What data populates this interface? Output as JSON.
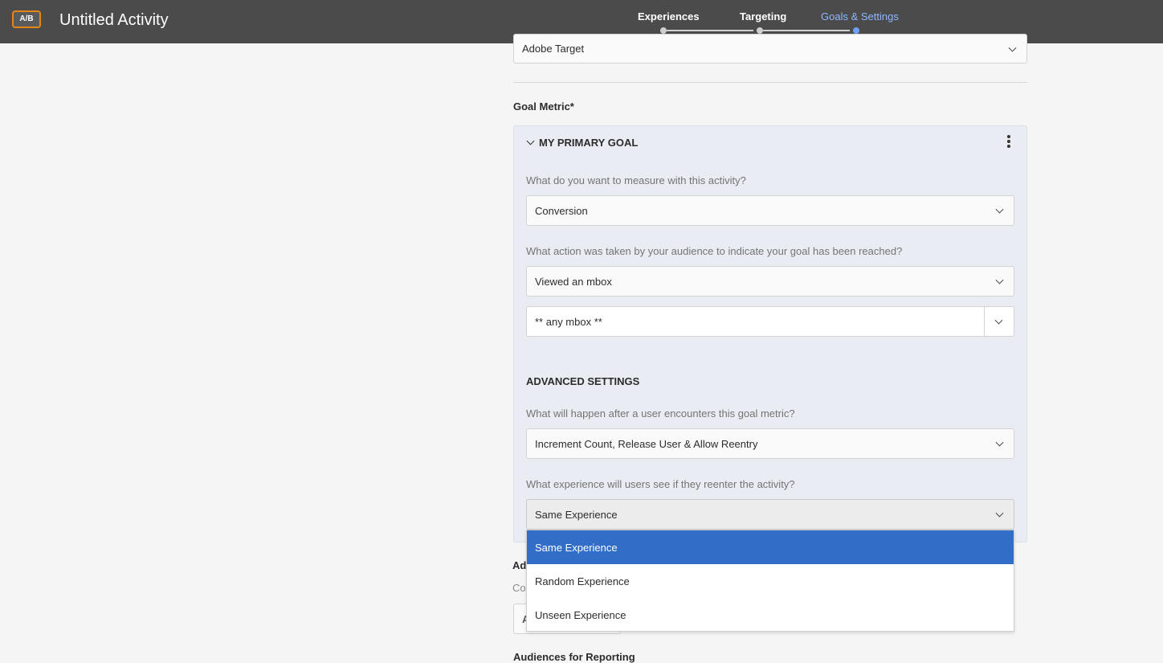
{
  "header": {
    "badge": "A/B",
    "title": "Untitled Activity",
    "steps": [
      {
        "label": "Experiences",
        "active": false
      },
      {
        "label": "Targeting",
        "active": false
      },
      {
        "label": "Goals & Settings",
        "active": true
      }
    ]
  },
  "reporting_source": {
    "value": "Adobe Target"
  },
  "goal_metric": {
    "section_label": "Goal Metric*",
    "panel_title": "MY PRIMARY GOAL",
    "q_measure": "What do you want to measure with this activity?",
    "measure_value": "Conversion",
    "q_action": "What action was taken by your audience to indicate your goal has been reached?",
    "action_value": "Viewed an mbox",
    "mbox_value": "** any mbox **",
    "advanced_title": "ADVANCED SETTINGS",
    "q_after": "What will happen after a user encounters this goal metric?",
    "after_value": "Increment Count, Release User & Allow Reentry",
    "q_reenter": "What experience will users see if they reenter the activity?",
    "reenter_value": "Same Experience",
    "reenter_options": [
      "Same Experience",
      "Random Experience",
      "Unseen Experience"
    ]
  },
  "below": {
    "peek_heading": "Ad",
    "peek_sub": "Co",
    "peek_button": "A",
    "audiences_label": "Audiences for Reporting"
  },
  "colors": {
    "accent": "#326ec8",
    "active_step": "#8fb6ff",
    "badge_border": "#e68619",
    "topbar": "#4b4b4b"
  },
  "icons": [
    "chevron-down-icon",
    "kebab-menu-icon"
  ]
}
